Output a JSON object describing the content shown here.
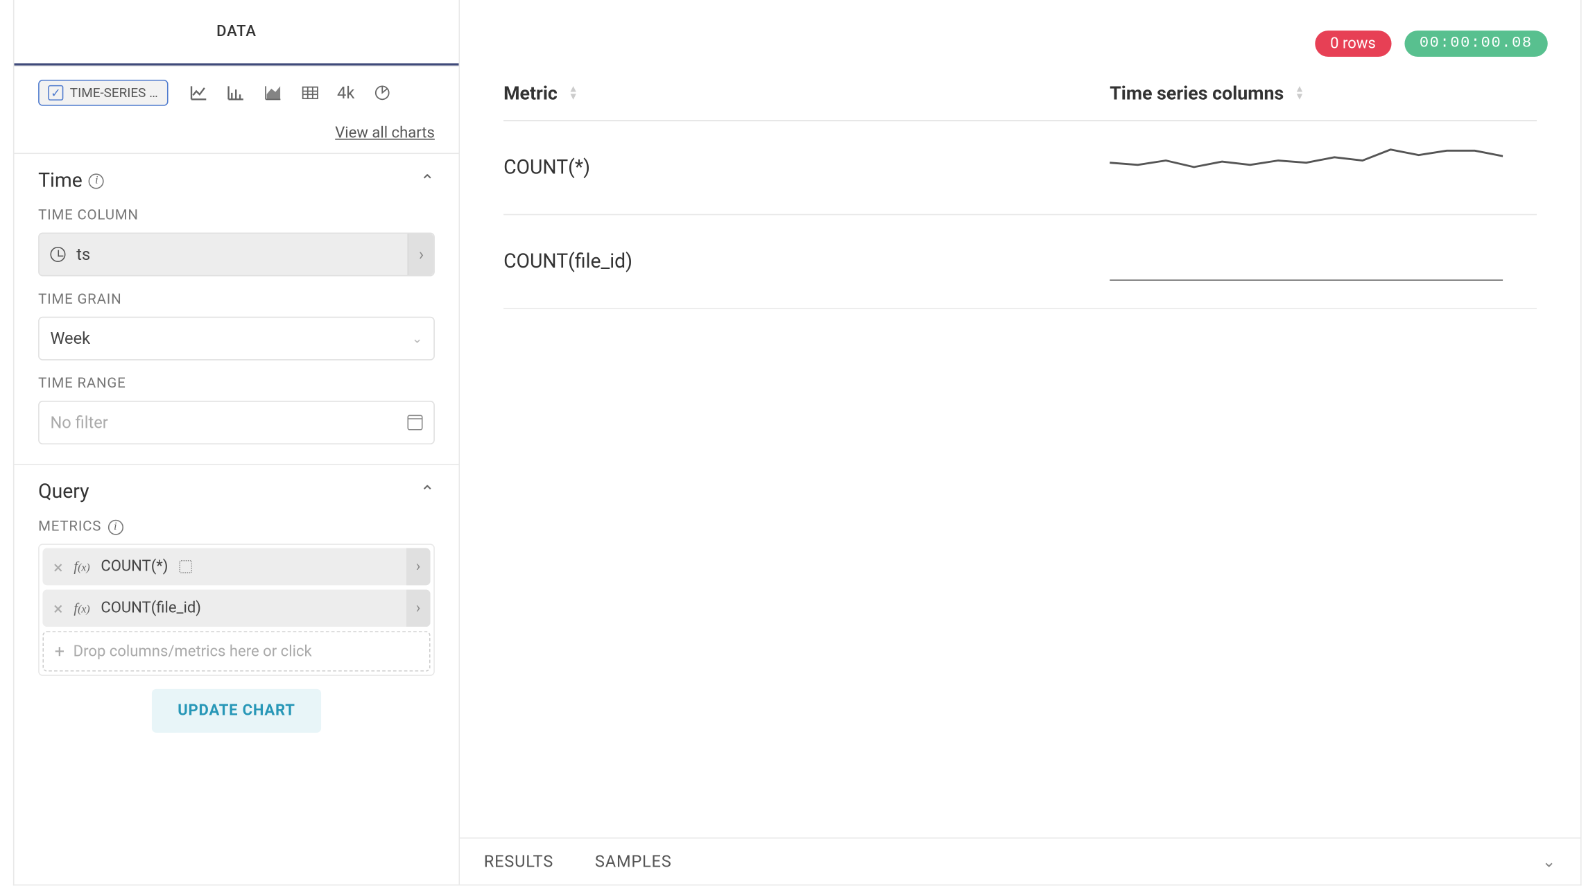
{
  "sidebar": {
    "tab": "DATA",
    "chart_chip": "TIME-SERIES …",
    "view_all": "View all charts",
    "chart_icons": [
      "line-chart-icon",
      "bar-chart-icon",
      "area-chart-icon",
      "table-icon",
      "big-number-icon",
      "pie-chart-icon"
    ],
    "big_number_text": "4k",
    "sections": {
      "time": {
        "title": "Time",
        "time_column_label": "TIME COLUMN",
        "time_column_value": "ts",
        "time_grain_label": "TIME GRAIN",
        "time_grain_value": "Week",
        "time_range_label": "TIME RANGE",
        "time_range_placeholder": "No filter"
      },
      "query": {
        "title": "Query",
        "metrics_label": "METRICS",
        "metrics": [
          {
            "label": "COUNT(*)",
            "has_extra_icon": true
          },
          {
            "label": "COUNT(file_id)",
            "has_extra_icon": false
          }
        ],
        "drop_placeholder": "Drop columns/metrics here or click"
      }
    },
    "update_button": "UPDATE CHART"
  },
  "main": {
    "rows_badge": "0 rows",
    "time_badge": "00:00:00.08",
    "columns": {
      "metric": "Metric",
      "timeseries": "Time series columns"
    },
    "rows": [
      {
        "metric": "COUNT(*)"
      },
      {
        "metric": "COUNT(file_id)"
      }
    ],
    "bottom_tabs": {
      "results": "RESULTS",
      "samples": "SAMPLES"
    }
  },
  "chart_data": [
    {
      "type": "line",
      "title": "COUNT(*)",
      "x": [
        0,
        1,
        2,
        3,
        4,
        5,
        6,
        7,
        8,
        9,
        10,
        11,
        12,
        13,
        14
      ],
      "values": [
        22,
        20,
        24,
        18,
        23,
        20,
        24,
        22,
        27,
        24,
        34,
        29,
        33,
        33,
        28
      ],
      "ylim": [
        0,
        40
      ]
    },
    {
      "type": "line",
      "title": "COUNT(file_id)",
      "x": [
        0,
        1,
        2,
        3,
        4,
        5,
        6,
        7,
        8,
        9,
        10,
        11,
        12,
        13,
        14
      ],
      "values": [
        0,
        0,
        0,
        0,
        0,
        0,
        0,
        0,
        0,
        0,
        0,
        0,
        0,
        0,
        0
      ],
      "ylim": [
        0,
        40
      ]
    }
  ]
}
